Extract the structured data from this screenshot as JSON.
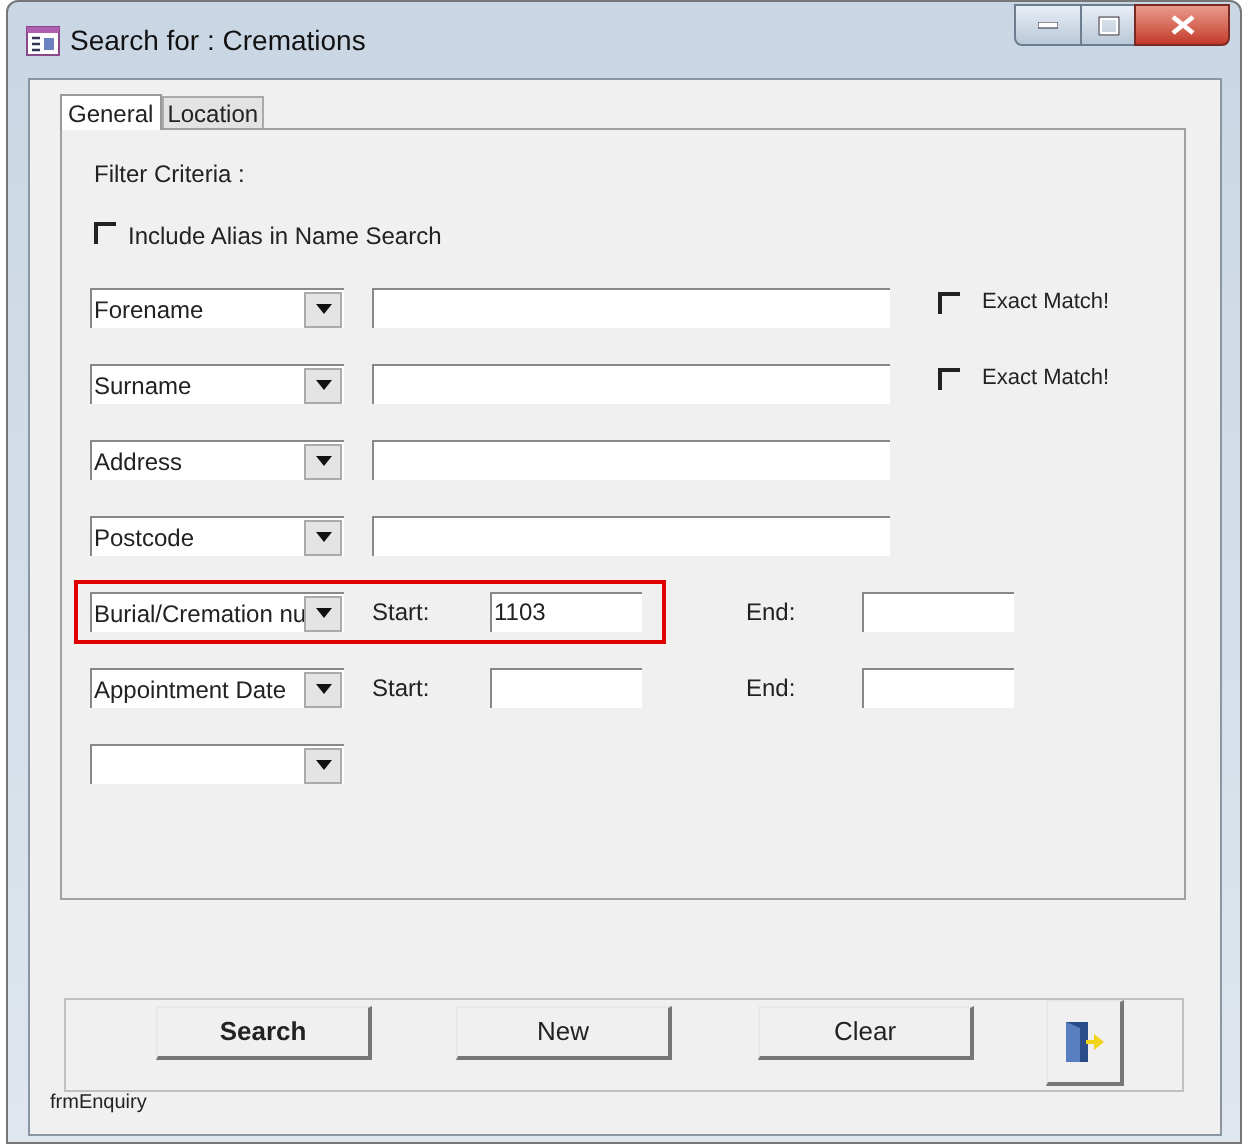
{
  "window": {
    "title": "Search for : Cremations"
  },
  "tabs": [
    {
      "label": "General",
      "selected": true
    },
    {
      "label": "Location",
      "selected": false
    }
  ],
  "filter_label": "Filter Criteria :",
  "alias_option": {
    "label": "Include Alias in Name Search",
    "checked": false
  },
  "criteria": [
    {
      "kind": "text",
      "field": "Forename",
      "exact_match": {
        "label": "Exact Match!",
        "checked": false
      },
      "highlighted": false
    },
    {
      "kind": "text",
      "field": "Surname",
      "exact_match": {
        "label": "Exact Match!",
        "checked": false
      },
      "highlighted": false
    },
    {
      "kind": "text",
      "field": "Address",
      "highlighted": false
    },
    {
      "kind": "text",
      "field": "Postcode",
      "highlighted": false
    },
    {
      "kind": "range",
      "field": "Burial/Cremation nu",
      "start_label": "Start:",
      "start_value": "1103",
      "end_label": "End:",
      "highlighted": true
    },
    {
      "kind": "range",
      "field": "Appointment Date",
      "start_label": "Start:",
      "end_label": "End:",
      "highlighted": false
    },
    {
      "kind": "empty",
      "highlighted": false
    }
  ],
  "buttons": [
    {
      "kind": "text",
      "label": "Search",
      "bold": true
    },
    {
      "kind": "text",
      "label": "New",
      "bold": false
    },
    {
      "kind": "text",
      "label": "Clear",
      "bold": false
    },
    {
      "kind": "exit"
    }
  ],
  "form_name": "frmEnquiry"
}
